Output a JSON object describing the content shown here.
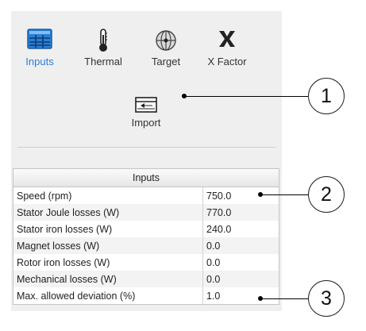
{
  "toolbar": {
    "tools": [
      {
        "label": "Inputs",
        "icon": "table-grid-icon",
        "active": true
      },
      {
        "label": "Thermal",
        "icon": "thermometer-icon",
        "active": false
      },
      {
        "label": "Target",
        "icon": "target-sphere-icon",
        "active": false
      },
      {
        "label": "X Factor",
        "icon": "x-factor-icon",
        "active": false
      }
    ],
    "import": {
      "label": "Import",
      "icon": "import-arrow-icon"
    },
    "active_color": "#2a7fd4"
  },
  "inputs_table": {
    "title": "Inputs",
    "rows": [
      {
        "name": "Speed (rpm)",
        "value": "750.0"
      },
      {
        "name": "Stator Joule losses (W)",
        "value": "770.0"
      },
      {
        "name": "Stator iron losses (W)",
        "value": "240.0"
      },
      {
        "name": "Magnet losses (W)",
        "value": "0.0"
      },
      {
        "name": "Rotor iron losses (W)",
        "value": "0.0"
      },
      {
        "name": "Mechanical losses (W)",
        "value": "0.0"
      },
      {
        "name": "Max. allowed deviation (%)",
        "value": "1.0"
      }
    ]
  },
  "callouts": [
    {
      "number": "1"
    },
    {
      "number": "2"
    },
    {
      "number": "3"
    }
  ]
}
